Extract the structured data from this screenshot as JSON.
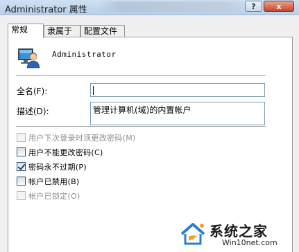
{
  "window": {
    "title": "Administrator 属性",
    "help_label": "?",
    "close_label": "x"
  },
  "tabs": [
    {
      "label": "常规"
    },
    {
      "label": "隶属于"
    },
    {
      "label": "配置文件"
    }
  ],
  "user": {
    "name": "Administrator",
    "icon": "user-account-icon"
  },
  "form": {
    "fullname_label": "全名(F):",
    "fullname_value": "",
    "description_label": "描述(D):",
    "description_value": "管理计算机(域)的内置帐户"
  },
  "options": [
    {
      "label": "用户下次登录时须更改密码(M)",
      "checked": false,
      "enabled": false
    },
    {
      "label": "用户不能更改密码(C)",
      "checked": false,
      "enabled": true
    },
    {
      "label": "密码永不过期(P)",
      "checked": true,
      "enabled": true
    },
    {
      "label": "帐户已禁用(B)",
      "checked": false,
      "enabled": true
    },
    {
      "label": "帐户已锁定(O)",
      "checked": false,
      "enabled": false
    }
  ],
  "watermark": {
    "brand": "系统之家",
    "url": "Win10net.com"
  },
  "colors": {
    "titlebar": "#b9d1ea",
    "close_button": "#c5452c",
    "input_border": "#7a9cbe"
  }
}
